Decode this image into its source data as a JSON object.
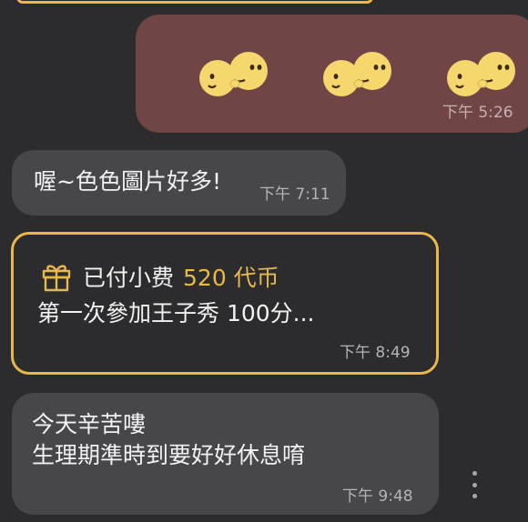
{
  "messages": {
    "sticker_message": {
      "time": "下午 5:26",
      "sticker_count": 3,
      "sticker_color": "#f5d76e"
    },
    "reply_1": {
      "text": "喔~色色圖片好多!",
      "time": "下午 7:11"
    },
    "tip_card": {
      "label": "已付小费",
      "amount": "520 代币",
      "text": "第一次參加王子秀 100分...",
      "time": "下午 8:49",
      "accent_color": "#e7b84a"
    },
    "reply_2": {
      "line1": "今天辛苦嘍",
      "line2": "生理期準時到要好好休息唷",
      "time": "下午 9:48"
    }
  },
  "colors": {
    "background": "#2c2c2e",
    "outgoing_bubble": "#6f4545",
    "incoming_bubble": "#47474b"
  }
}
